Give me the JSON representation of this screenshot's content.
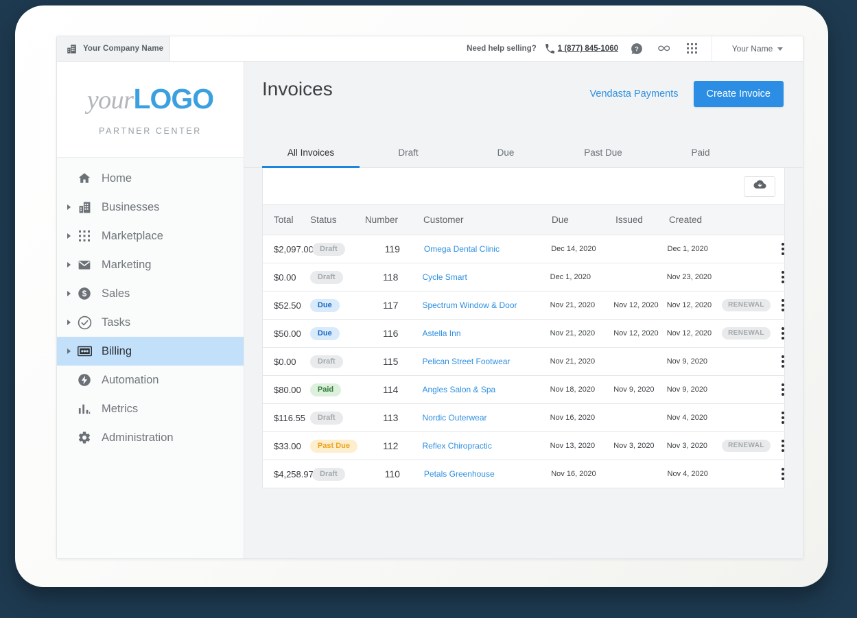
{
  "topbar": {
    "company_tab": "Your Company Name",
    "company_icon": "building-icon",
    "help_text": "Need help selling?",
    "phone_icon": "phone-icon",
    "phone": "1 (877) 845-1060",
    "help_icon": "help-circle-icon",
    "infinity_icon": "infinity-icon",
    "apps_icon": "apps-grid-icon",
    "username": "Your Name",
    "caret_icon": "chevron-down-icon"
  },
  "sidebar": {
    "logo_part1": "your",
    "logo_part2": "LOGO",
    "subtitle": "PARTNER CENTER",
    "items": [
      {
        "label": "Home",
        "icon": "home-icon",
        "expandable": false,
        "active": false
      },
      {
        "label": "Businesses",
        "icon": "building-icon",
        "expandable": true,
        "active": false
      },
      {
        "label": "Marketplace",
        "icon": "grid-dots-icon",
        "expandable": true,
        "active": false
      },
      {
        "label": "Marketing",
        "icon": "envelope-icon",
        "expandable": true,
        "active": false
      },
      {
        "label": "Sales",
        "icon": "dollar-circle-icon",
        "expandable": true,
        "active": false
      },
      {
        "label": "Tasks",
        "icon": "check-circle-icon",
        "expandable": true,
        "active": false
      },
      {
        "label": "Billing",
        "icon": "money-bill-icon",
        "expandable": true,
        "active": true
      },
      {
        "label": "Automation",
        "icon": "lightning-circle-icon",
        "expandable": false,
        "active": false
      },
      {
        "label": "Metrics",
        "icon": "bar-chart-icon",
        "expandable": false,
        "active": false
      },
      {
        "label": "Administration",
        "icon": "gear-icon",
        "expandable": false,
        "active": false
      }
    ]
  },
  "main": {
    "title": "Invoices",
    "payments_link": "Vendasta Payments",
    "create_button": "Create Invoice",
    "download_icon": "cloud-download-icon",
    "tabs": [
      {
        "label": "All Invoices",
        "active": true
      },
      {
        "label": "Draft",
        "active": false
      },
      {
        "label": "Due",
        "active": false
      },
      {
        "label": "Past Due",
        "active": false
      },
      {
        "label": "Paid",
        "active": false
      }
    ],
    "columns": {
      "total": "Total",
      "status": "Status",
      "number": "Number",
      "customer": "Customer",
      "due": "Due",
      "issued": "Issued",
      "created": "Created"
    },
    "rows": [
      {
        "total": "$2,097.00",
        "status": "Draft",
        "status_kind": "draft",
        "number": "119",
        "customer": "Omega Dental Clinic",
        "due": "Dec 14, 2020",
        "issued": "",
        "created": "Dec 1, 2020",
        "tag": ""
      },
      {
        "total": "$0.00",
        "status": "Draft",
        "status_kind": "draft",
        "number": "118",
        "customer": "Cycle Smart",
        "due": "Dec 1, 2020",
        "issued": "",
        "created": "Nov 23, 2020",
        "tag": ""
      },
      {
        "total": "$52.50",
        "status": "Due",
        "status_kind": "due",
        "number": "117",
        "customer": "Spectrum Window & Door",
        "due": "Nov 21, 2020",
        "issued": "Nov 12, 2020",
        "created": "Nov 12, 2020",
        "tag": "RENEWAL"
      },
      {
        "total": "$50.00",
        "status": "Due",
        "status_kind": "due",
        "number": "116",
        "customer": "Astella Inn",
        "due": "Nov 21, 2020",
        "issued": "Nov 12, 2020",
        "created": "Nov 12, 2020",
        "tag": "RENEWAL"
      },
      {
        "total": "$0.00",
        "status": "Draft",
        "status_kind": "draft",
        "number": "115",
        "customer": "Pelican Street Footwear",
        "due": "Nov 21, 2020",
        "issued": "",
        "created": "Nov 9, 2020",
        "tag": ""
      },
      {
        "total": "$80.00",
        "status": "Paid",
        "status_kind": "paid",
        "number": "114",
        "customer": "Angles Salon & Spa",
        "due": "Nov 18, 2020",
        "issued": "Nov 9, 2020",
        "created": "Nov 9, 2020",
        "tag": ""
      },
      {
        "total": "$116.55",
        "status": "Draft",
        "status_kind": "draft",
        "number": "113",
        "customer": "Nordic Outerwear",
        "due": "Nov 16, 2020",
        "issued": "",
        "created": "Nov 4, 2020",
        "tag": ""
      },
      {
        "total": "$33.00",
        "status": "Past Due",
        "status_kind": "pastdue",
        "number": "112",
        "customer": "Reflex Chiropractic",
        "due": "Nov 13, 2020",
        "issued": "Nov 3, 2020",
        "created": "Nov 3, 2020",
        "tag": "RENEWAL"
      },
      {
        "total": "$4,258.97",
        "status": "Draft",
        "status_kind": "draft",
        "number": "110",
        "customer": "Petals Greenhouse",
        "due": "Nov 16, 2020",
        "issued": "",
        "created": "Nov 4, 2020",
        "tag": ""
      }
    ]
  },
  "colors": {
    "accent_blue": "#2b8ee4",
    "link_blue": "#2d8fe0",
    "active_nav": "#c3e0fb",
    "page_bg": "#1e3a50",
    "status_draft": "#a3a8ac",
    "status_due": "#1668c4",
    "status_paid": "#2f7d34",
    "status_pastdue": "#eda320"
  }
}
